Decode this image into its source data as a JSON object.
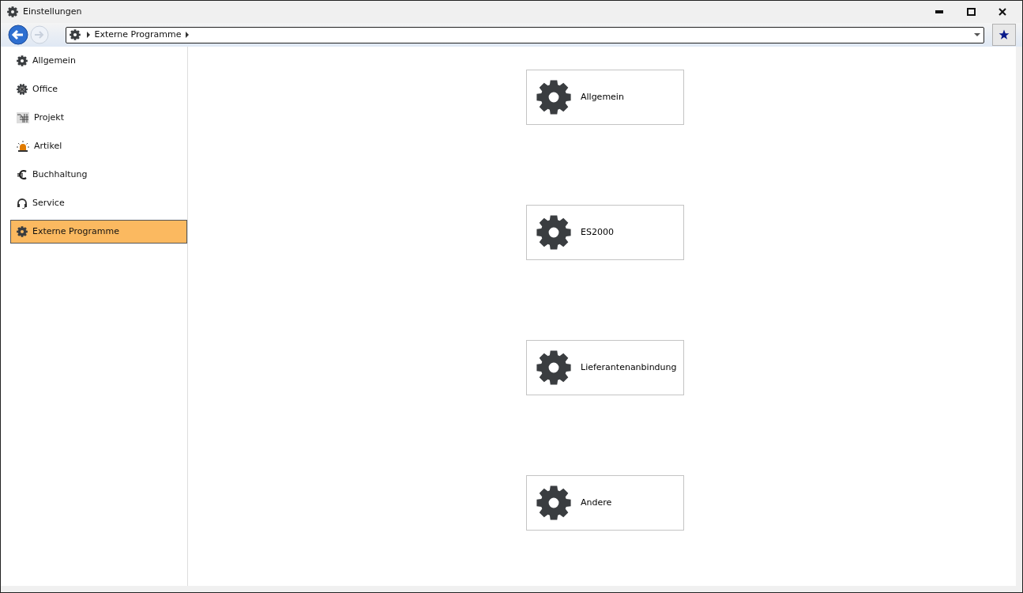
{
  "window": {
    "title": "Einstellungen"
  },
  "breadcrumb": {
    "items": [
      "Externe Programme"
    ]
  },
  "sidebar": {
    "items": [
      {
        "label": "Allgemein",
        "kind": "gear",
        "selected": false
      },
      {
        "label": "Office",
        "kind": "office",
        "selected": false
      },
      {
        "label": "Projekt",
        "kind": "project",
        "selected": false
      },
      {
        "label": "Artikel",
        "kind": "beacon",
        "selected": false
      },
      {
        "label": "Buchhaltung",
        "kind": "euro",
        "selected": false
      },
      {
        "label": "Service",
        "kind": "headset",
        "selected": false
      },
      {
        "label": "Externe Programme",
        "kind": "gear",
        "selected": true
      }
    ]
  },
  "tiles": [
    {
      "label": "Allgemein"
    },
    {
      "label": "ES2000"
    },
    {
      "label": "Lieferantenanbindung"
    },
    {
      "label": "Andere"
    }
  ]
}
